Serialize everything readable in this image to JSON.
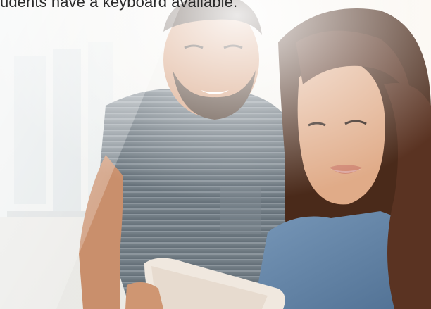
{
  "caption": {
    "text": "udents have a keyboard available."
  },
  "photo": {
    "subject": "two-people-using-tablet-photo"
  },
  "colors": {
    "background": "#f4f2ef",
    "caption_text": "#2b2b2b",
    "shirt_man": "#6f7b84",
    "shirt_woman": "#5c7fa6",
    "hair_woman": "#4a2a1a",
    "skin": "#d6a07e"
  }
}
